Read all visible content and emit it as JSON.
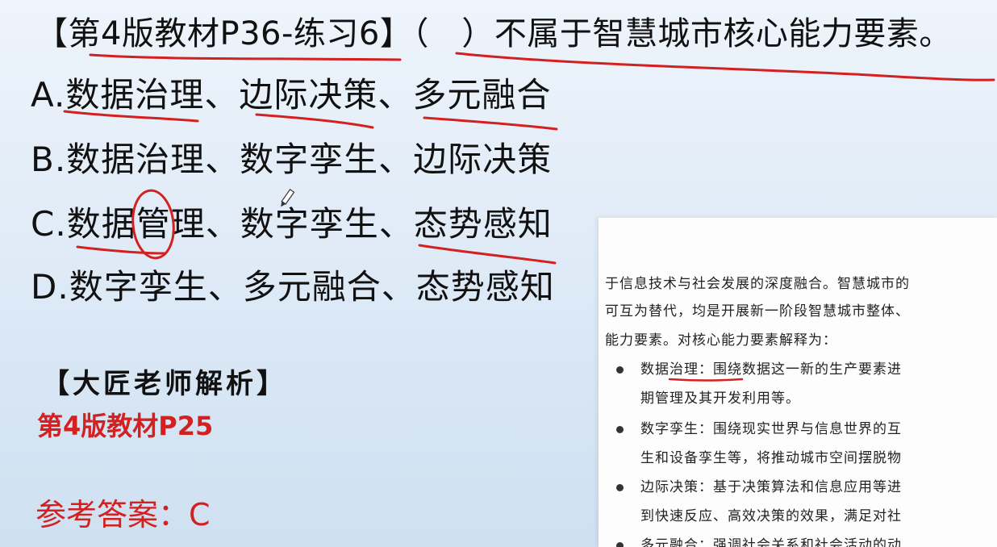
{
  "question": {
    "source": "【第4版教材P36-练习6】",
    "blank": "（　）",
    "stem": "不属于智慧城市核心能力要素。"
  },
  "options": [
    {
      "letter": "A.",
      "text": "数据治理、边际决策、多元融合"
    },
    {
      "letter": "B.",
      "text": "数据治理、数字孪生、边际决策"
    },
    {
      "letter": "C.",
      "text_prefix": "数据",
      "text_circled": "管",
      "text_suffix": "理、数字孪生、态势感知"
    },
    {
      "letter": "D.",
      "text": "数字孪生、多元融合、态势感知"
    }
  ],
  "analysis": {
    "title": "【大匠老师解析】",
    "reference": "第4版教材P25"
  },
  "answer": {
    "label": "参考答案：",
    "value": "C"
  },
  "book": {
    "lines": [
      "于信息技术与社会发展的深度融合。智慧城市的",
      "可互为替代，均是开展新一阶段智慧城市整体、",
      "能力要素。对核心能力要素解释为："
    ],
    "items": [
      {
        "term": "数据治理",
        "rest": "：围绕数据这一新的生产要素进",
        "line2": "期管理及其开发利用等。"
      },
      {
        "term": "数字孪生",
        "rest": "：围绕现实世界与信息世界的互",
        "line2": "生和设备孪生等，将推动城市空间摆脱物"
      },
      {
        "term": "边际决策",
        "rest": "：基于决策算法和信息应用等进",
        "line2": "到快速反应、高效决策的效果，满足对社"
      },
      {
        "term": "多元融合",
        "rest": "：强调社会关系和社会活动的动",
        "line2": ""
      }
    ]
  },
  "colors": {
    "annotation_red": "#d32020",
    "background": "#dce9f6"
  }
}
